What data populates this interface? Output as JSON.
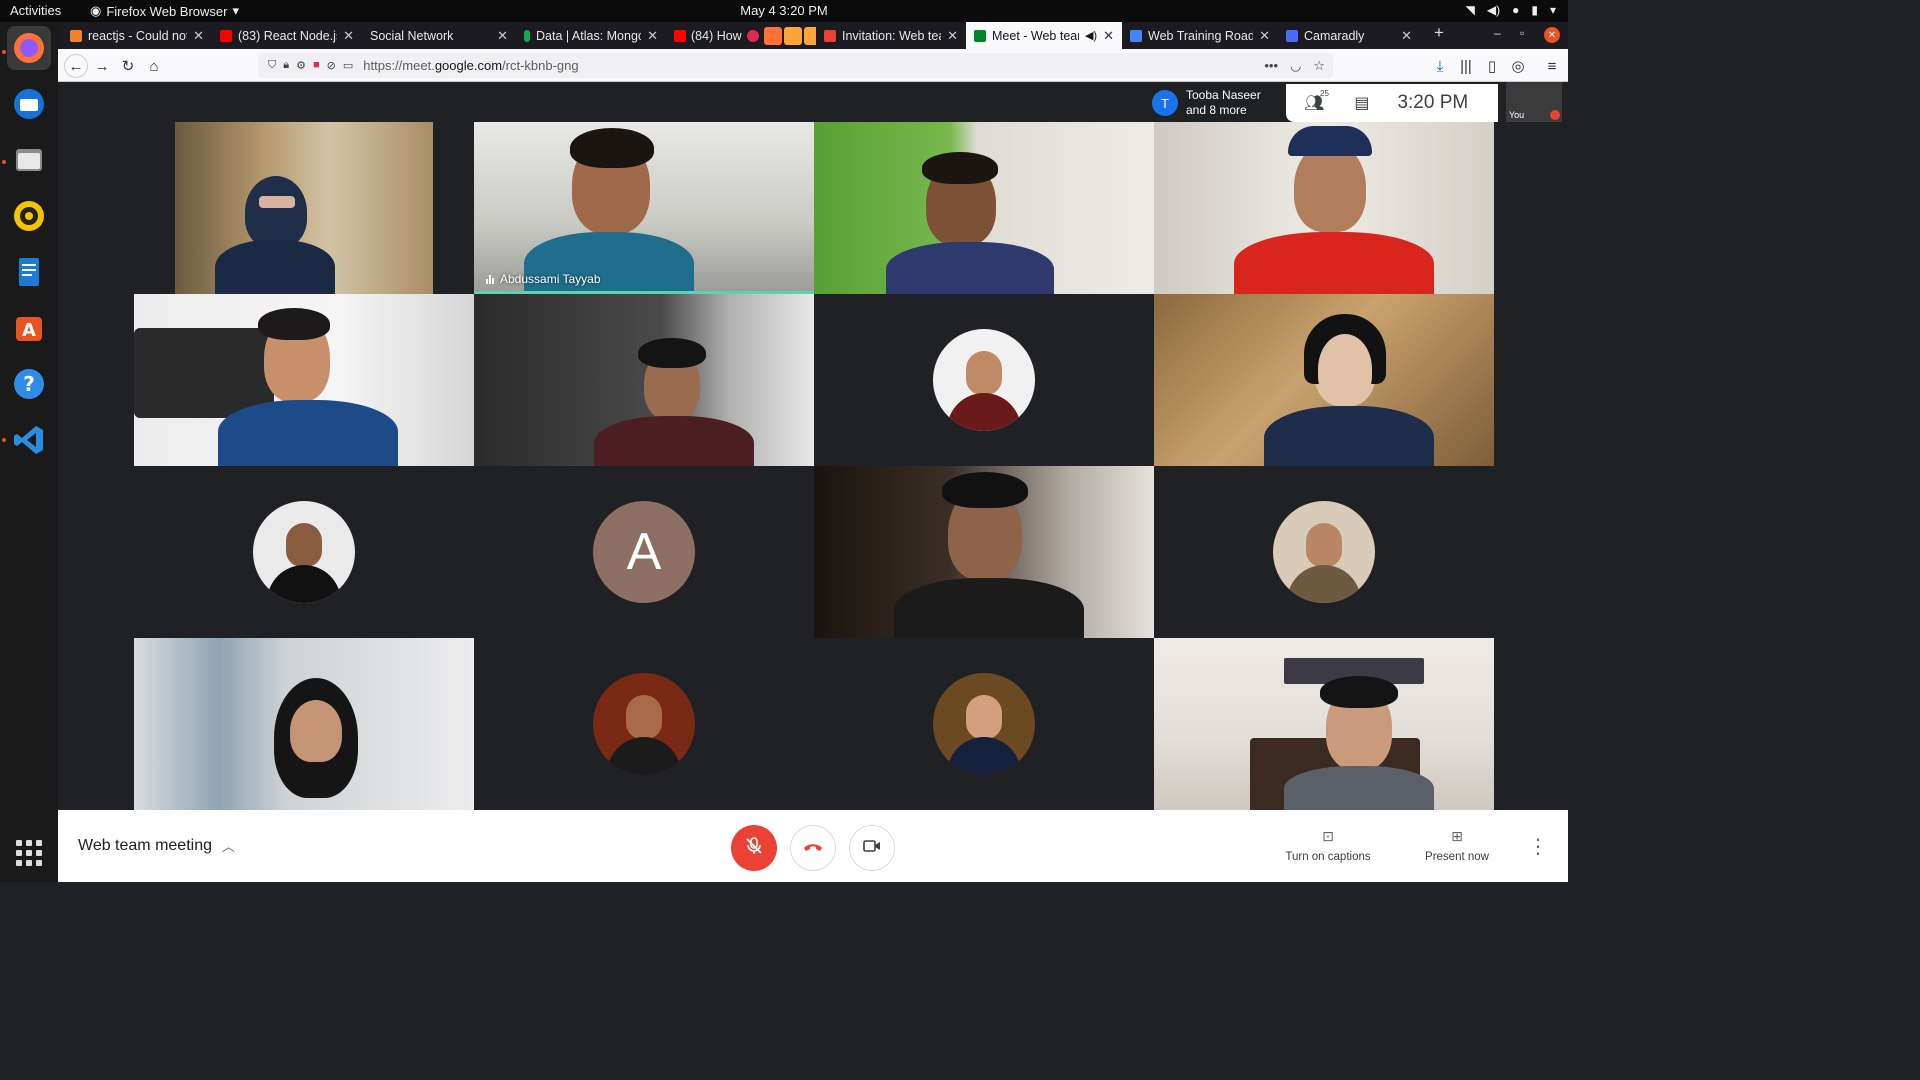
{
  "os_bar": {
    "activities": "Activities",
    "app_name": "Firefox Web Browser",
    "clock": "May 4  3:20 PM"
  },
  "dock": {
    "items": [
      "firefox-icon",
      "thunderbird-icon",
      "files-icon",
      "rhythmbox-icon",
      "libreoffice-writer-icon",
      "software-icon",
      "help-icon",
      "vscode-icon"
    ]
  },
  "tabs": [
    {
      "title": "reactjs - Could not",
      "fav_color": "#f48024"
    },
    {
      "title": "(83) React Node.js",
      "fav_color": "#ff0000"
    },
    {
      "title": "Social Network",
      "fav_color": ""
    },
    {
      "title": "Data | Atlas: Mongo",
      "fav_color": "#13aa52"
    },
    {
      "title": "(84) How",
      "fav_color": "#ff0000"
    },
    {
      "title": "Invitation: Web tea",
      "fav_color": "#ea4335"
    },
    {
      "title": "Meet - Web tean",
      "fav_color": "#00832d",
      "active": true
    },
    {
      "title": "Web Training Road",
      "fav_color": "#4285f4"
    },
    {
      "title": "Camaradly",
      "fav_color": "#4a6cf7"
    }
  ],
  "navbar": {
    "url_prefix": "https://meet.",
    "url_domain": "google.com",
    "url_path": "/rct-kbnb-gng"
  },
  "meet": {
    "presenter": {
      "initial": "T",
      "name": "Tooba Naseer",
      "others": "and 8 more"
    },
    "participant_count": "25",
    "time": "3:20 PM",
    "self_label": "You",
    "speaker_name": "Abdussami Tayyab",
    "avatar_letter": "A",
    "meeting_name": "Web team meeting",
    "captions_label": "Turn on captions",
    "present_label": "Present now"
  },
  "colors": {
    "end_call": "#ea4335",
    "speaking_border": "#5bd3b0",
    "letter_avatar": "#8d6e63"
  }
}
